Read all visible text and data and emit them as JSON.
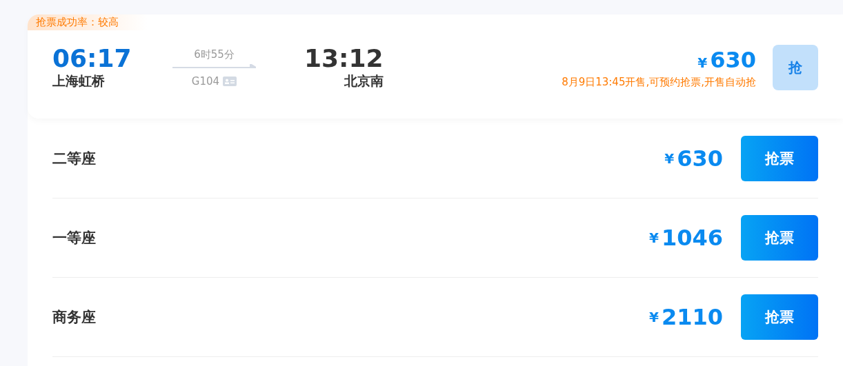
{
  "train": {
    "badge": "抢票成功率：较高",
    "depart_time": "06:17",
    "depart_station": "上海虹桥",
    "duration": "6时55分",
    "train_no": "G104",
    "arrive_time": "13:12",
    "arrive_station": "北京南",
    "currency": "¥",
    "price": "630",
    "sale_note": "8月9日13:45开售,可预约抢票,开售自动抢",
    "button": "抢"
  },
  "seats": [
    {
      "name": "二等座",
      "currency": "¥",
      "price": "630",
      "button": "抢票"
    },
    {
      "name": "一等座",
      "currency": "¥",
      "price": "1046",
      "button": "抢票"
    },
    {
      "name": "商务座",
      "currency": "¥",
      "price": "2110",
      "button": "抢票"
    }
  ]
}
